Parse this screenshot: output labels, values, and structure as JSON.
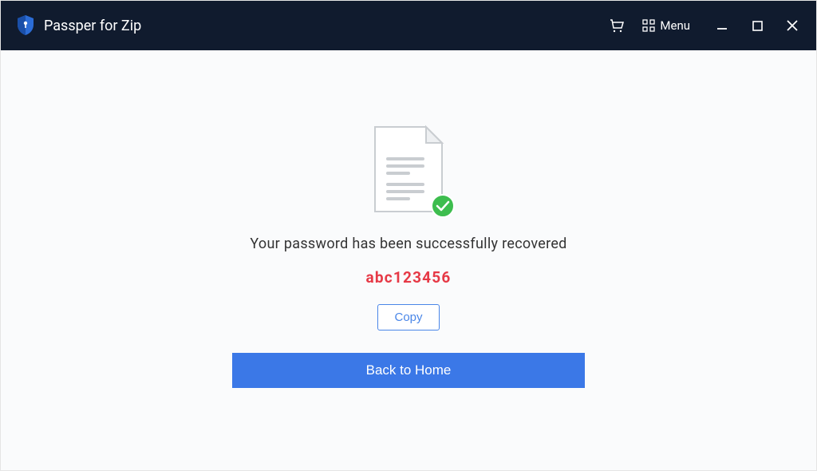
{
  "titlebar": {
    "app_name": "Passper for Zip",
    "menu_label": "Menu"
  },
  "content": {
    "success_message": "Your password has been successfully recovered",
    "password": "abc123456",
    "copy_label": "Copy",
    "back_label": "Back to Home"
  },
  "colors": {
    "titlebar_bg": "#101b2e",
    "content_bg": "#fafbfc",
    "success_green": "#3dbd4e",
    "password_red": "#e63946",
    "primary_blue": "#3b78e7",
    "accent_blue": "#4a86e8"
  }
}
